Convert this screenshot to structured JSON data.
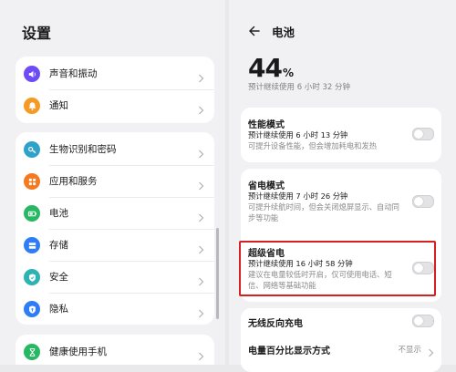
{
  "left": {
    "title": "设置",
    "groups": [
      {
        "items": [
          {
            "label": "声音和振动",
            "icon": "speaker-icon",
            "color": "#6d4cf6"
          },
          {
            "label": "通知",
            "icon": "bell-icon",
            "color": "#f59a23"
          }
        ]
      },
      {
        "items": [
          {
            "label": "生物识别和密码",
            "icon": "key-icon",
            "color": "#2fa2c9"
          },
          {
            "label": "应用和服务",
            "icon": "apps-grid-icon",
            "color": "#f4791f"
          },
          {
            "label": "电池",
            "icon": "battery-icon",
            "color": "#27b864"
          },
          {
            "label": "存储",
            "icon": "storage-icon",
            "color": "#2f7df6"
          },
          {
            "label": "安全",
            "icon": "shield-check-icon",
            "color": "#2db3b3"
          },
          {
            "label": "隐私",
            "icon": "privacy-shield-icon",
            "color": "#2f7df6"
          }
        ]
      },
      {
        "items": [
          {
            "label": "健康使用手机",
            "icon": "hourglass-icon",
            "color": "#27b864"
          }
        ]
      }
    ]
  },
  "right": {
    "title": "电池",
    "percent": "44",
    "percent_unit": "%",
    "estimate": "预计继续使用 6 小时 32 分钟",
    "modes": [
      {
        "title": "性能模式",
        "line": "预计继续使用 6 小时 13 分钟",
        "desc": "可提升设备性能，但会增加耗电和发热",
        "enabled": false
      },
      {
        "title": "省电模式",
        "line": "预计继续使用 7 小时 26 分钟",
        "desc": "可提升续航时间，但会关闭熄屏显示、自动同步等功能",
        "enabled": false
      },
      {
        "title": "超级省电",
        "line": "预计继续使用 16 小时 58 分钟",
        "desc": "建议在电量较低时开启，仅可使用电话、短信、网络等基础功能",
        "enabled": false
      }
    ],
    "wireless_reverse": {
      "title": "无线反向充电",
      "enabled": false
    },
    "percent_display": {
      "title": "电量百分比显示方式",
      "value": "不显示"
    }
  },
  "colors": {
    "highlight": "#d32020"
  }
}
